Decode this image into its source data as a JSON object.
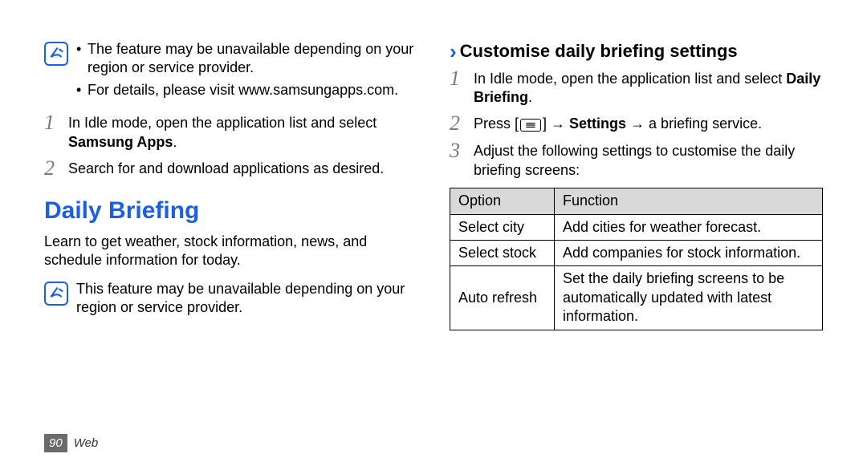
{
  "left": {
    "note": {
      "bullets": [
        "The feature may be unavailable depending on your region or service provider.",
        "For details, please visit www.samsungapps.com."
      ]
    },
    "steps": [
      {
        "n": "1",
        "pre": "In Idle mode, open the application list and select ",
        "bold": "Samsung Apps",
        "post": "."
      },
      {
        "n": "2",
        "pre": "Search for and download applications as desired.",
        "bold": "",
        "post": ""
      }
    ],
    "heading": "Daily Briefing",
    "desc": "Learn to get weather, stock information, news, and schedule information for today.",
    "note2": "This feature may be unavailable depending on your region or service provider."
  },
  "right": {
    "subhead": "Customise daily briefing settings",
    "steps": {
      "s1_pre": "In Idle mode, open the application list and select ",
      "s1_bold": "Daily Briefing",
      "s1_post": ".",
      "s2_pre": "Press [",
      "s2_arrow1": "] → ",
      "s2_bold": "Settings",
      "s2_arrow2": " → a briefing service.",
      "s3": "Adjust the following settings to customise the daily briefing screens:"
    },
    "table": {
      "h1": "Option",
      "h2": "Function",
      "rows": [
        {
          "opt": "Select city",
          "fn": "Add cities for weather forecast."
        },
        {
          "opt": "Select stock",
          "fn": "Add companies for stock information."
        },
        {
          "opt": "Auto refresh",
          "fn": "Set the daily briefing screens to be automatically updated with latest information."
        }
      ]
    }
  },
  "footer": {
    "page": "90",
    "section": "Web"
  }
}
